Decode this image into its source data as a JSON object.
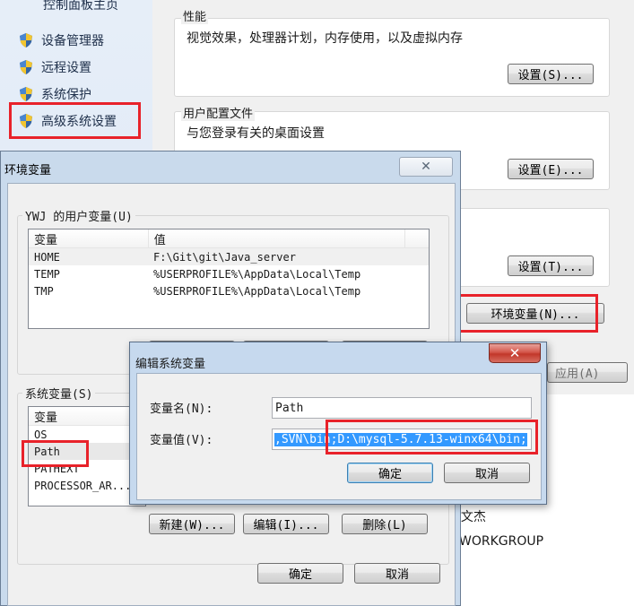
{
  "nav": {
    "top_partial": "控制面板主页",
    "items": [
      "设备管理器",
      "远程设置",
      "系统保护",
      "高级系统设置"
    ]
  },
  "sysprops": {
    "perf_title": "性能",
    "perf_desc": "视觉效果，处理器计划，内存使用，以及虚拟内存",
    "perf_btn": "设置(S)...",
    "profile_title": "用户配置文件",
    "profile_desc": "与您登录有关的桌面设置",
    "profile_btn": "设置(E)...",
    "startup_btn": "设置(T)...",
    "env_btn": "环境变量(N)...",
    "apply_partial": "应用(A)",
    "bg_text_1": "E文杰",
    "bg_text_2": "WORKGROUP"
  },
  "envvars": {
    "title": "环境变量",
    "close": "✕",
    "user_group_label": "YWJ 的用户变量(U)",
    "col_var": "变量",
    "col_val": "值",
    "user_vars": [
      {
        "name": "HOME",
        "value": "F:\\Git\\git\\Java_server"
      },
      {
        "name": "TEMP",
        "value": "%USERPROFILE%\\AppData\\Local\\Temp"
      },
      {
        "name": "TMP",
        "value": "%USERPROFILE%\\AppData\\Local\\Temp"
      }
    ],
    "sys_group_label": "系统变量(S)",
    "sys_vars": [
      "OS",
      "Path",
      "PATHEXT",
      "PROCESSOR_AR..."
    ],
    "btn_new": "新建(W)...",
    "btn_edit": "编辑(I)...",
    "btn_delete": "删除(L)",
    "btn_ok": "确定",
    "btn_cancel": "取消"
  },
  "edit": {
    "title": "编辑系统变量",
    "close": "✕",
    "name_label": "变量名(N):",
    "name_value": "Path",
    "value_label": "变量值(V):",
    "value_value": ",SVN\\bin;D:\\mysql-5.7.13-winx64\\bin;",
    "btn_ok": "确定",
    "btn_cancel": "取消"
  },
  "colors": {
    "highlight_red": "#e8222a",
    "selection_blue": "#3399ff"
  }
}
